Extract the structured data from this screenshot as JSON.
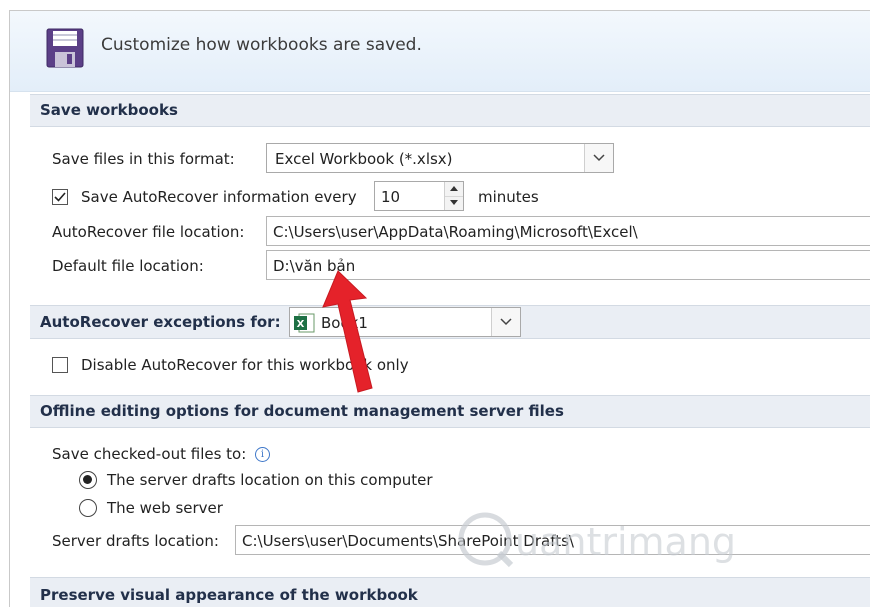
{
  "banner": {
    "title": "Customize how workbooks are saved."
  },
  "save_workbooks": {
    "section_title": "Save workbooks",
    "format_label": "Save files in this format:",
    "format_value": "Excel Workbook (*.xlsx)",
    "autorecover_checkbox_label": "Save AutoRecover information every",
    "autorecover_checked": true,
    "autorecover_minutes": "10",
    "minutes_label": "minutes",
    "autorecover_location_label": "AutoRecover file location:",
    "autorecover_location_value": "C:\\Users\\user\\AppData\\Roaming\\Microsoft\\Excel\\",
    "default_location_label": "Default file location:",
    "default_location_value": "D:\\văn bản"
  },
  "autorecover_exceptions": {
    "section_label": "AutoRecover exceptions for:",
    "workbook_value": "Book1",
    "disable_label": "Disable AutoRecover for this workbook only",
    "disable_checked": false
  },
  "offline": {
    "section_title": "Offline editing options for document management server files",
    "save_checked_out_label": "Save checked-out files to:",
    "option_server_drafts": "The server drafts location on this computer",
    "option_web_server": "The web server",
    "selected_option": "server_drafts",
    "server_drafts_label": "Server drafts location:",
    "server_drafts_value": "C:\\Users\\user\\Documents\\SharePoint Drafts\\"
  },
  "preserve": {
    "section_title": "Preserve visual appearance of the workbook"
  },
  "watermark": {
    "text": "uantrimang"
  },
  "colors": {
    "accent": "#3f78c9",
    "arrow": "#e5222a",
    "section_bg": "#eaeef4",
    "excel_green": "#1e7145"
  },
  "icons": [
    "save-disk-icon",
    "dropdown-chevron-icon",
    "checkbox-check-icon",
    "spin-up-icon",
    "spin-down-icon",
    "excel-file-icon",
    "info-icon",
    "red-arrow-annotation"
  ]
}
